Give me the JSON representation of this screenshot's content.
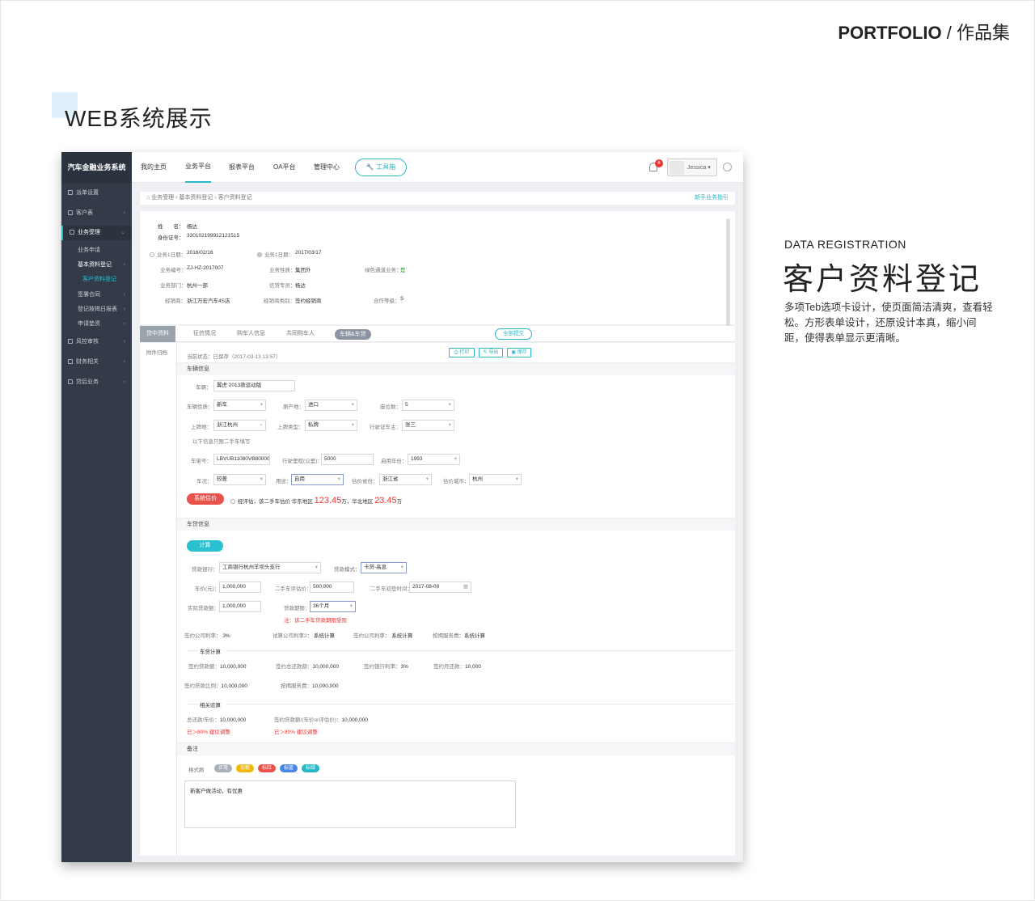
{
  "header": {
    "portfolio": "PORTFOLIO",
    "portfolio_cn": "/ 作品集"
  },
  "section_title": "WEB系统展示",
  "description": {
    "en": "DATA REGISTRATION",
    "cn": "客户资料登记",
    "text": "多项Teb选项卡设计，使页面简洁清爽，查看轻松。方形表单设计，还原设计本真，缩小间距，使得表单显示更清晰。"
  },
  "app": {
    "brand": "汽车金融业务系统",
    "sidebar": [
      {
        "label": "派单设置",
        "icon": "list-icon"
      },
      {
        "label": "客户表",
        "icon": "user-icon"
      },
      {
        "label": "业务受理",
        "icon": "gear-icon",
        "active": true
      },
      {
        "label": "业务申请"
      },
      {
        "label": "基本资料登记"
      },
      {
        "label": "客户资料登记"
      },
      {
        "label": "签署合同"
      },
      {
        "label": "登记按揭日报表"
      },
      {
        "label": "申请垫资"
      },
      {
        "label": "风控审核",
        "icon": "shield-icon"
      },
      {
        "label": "财务相关",
        "icon": "money-icon"
      },
      {
        "label": "贷后业务",
        "icon": "grid-icon"
      }
    ],
    "topnav": [
      "我的主页",
      "业务平台",
      "报表平台",
      "OA平台",
      "管理中心"
    ],
    "toolbox": "工具箱",
    "notification_count": "6",
    "username": "Jessica",
    "breadcrumb": [
      "业务受理",
      "基本资料登记",
      "客户资料登记"
    ],
    "guide": "新手业务指引",
    "customer": {
      "name_label": "姓　　名：",
      "name": "杨达",
      "id_label": "身份证号：",
      "id": "330102199912121515",
      "date1_label": "业务1日期：",
      "date1": "2016/02/16",
      "date2_label": "业务1日期：",
      "date2": "2017/03/17",
      "bizno_label": "业务编号：",
      "bizno": "ZJ-HZ-2017007",
      "biztype_label": "业务性质：",
      "biztype": "集团外",
      "green_label": "绿色通道业务：",
      "green": "是",
      "dept_label": "业务部门：",
      "dept": "杭州一部",
      "credit_label": "信贷专员：",
      "credit": "杨达",
      "dealer_label": "经销商：",
      "dealer": "浙江万宏汽车4S店",
      "dealertype_label": "经销商类别：",
      "dealertype": "签约经销商",
      "level_label": "合作等级：",
      "level": "S"
    },
    "tabs": [
      "贷中资料",
      "征信情况",
      "购车人信息",
      "共同购车人",
      "车辆&车贷"
    ],
    "all_submit": "全部提交",
    "archive": "附件归档",
    "status": "当前状态：已保存（2017-03-13 13:57）",
    "actions": {
      "print": "打印",
      "export": "导出",
      "save": "保存"
    },
    "vehicle": {
      "title": "车辆信息",
      "car_label": "车辆：",
      "car": "翼虎 2013款运动版",
      "nature_label": "车辆性质：",
      "nature": "新车",
      "origin_label": "原产地：",
      "origin": "进口",
      "seats_label": "座位数：",
      "seats": "5",
      "plate_label": "上牌地：",
      "plate": "浙江杭州",
      "platetype_label": "上牌类型：",
      "platetype": "私牌",
      "owner_label": "行驶证车主：",
      "owner": "张三",
      "note": "以下信息只限二手车填写",
      "vin_label": "车架号：",
      "vin": "LBVUB11080VB80000",
      "mileage_label": "行驶里程(公里)：",
      "mileage": "5000",
      "year_label": "启用年份：",
      "year": "1993",
      "condition_label": "车况：",
      "condition": "较差",
      "usage_label": "用途：",
      "usage": "自用",
      "province_label": "估价省份：",
      "province": "浙江省",
      "city_label": "估价城市：",
      "city": "杭州",
      "eval_btn": "系统估价",
      "eval_text1": "经评估，该二手车估价 华东地区",
      "eval_val1": "123.45",
      "eval_unit1": "万，华北地区",
      "eval_val2": "23.45",
      "eval_unit2": "万"
    },
    "loan": {
      "title": "车贷信息",
      "calc_btn": "计算",
      "bank_label": "贷款银行：",
      "bank": "工商银行杭州羊坝头支行",
      "mode_label": "贷款模式：",
      "mode": "卡贷-高息",
      "price_label": "车价(元)：",
      "price": "1,000,000",
      "eval_label": "二手车评估价：",
      "eval": "500,000",
      "evaltime_label": "二手车初登时间：",
      "evaltime": "2017-08-09",
      "amount_label": "实际贷款额：",
      "amount": "1,000,000",
      "term_label": "贷款期限：",
      "term": "36个月",
      "warn": "注：该二手车贷款期限受限",
      "rate1_label": "签约公司利率：",
      "rate1": "3%",
      "rate2_label": "试算公司利率2：",
      "rate2": "系统计算",
      "rate3_label": "签约公司利率：",
      "rate3": "系统计算",
      "fee_label": "按揭服务费：",
      "fee": "系统计算",
      "calc_title": "车贷计算",
      "c1_label": "签约贷款额：",
      "c1": "10,000,000",
      "c2_label": "签约总还款额：",
      "c2": "10,000,000",
      "c3_label": "签约银行利率：",
      "c3": "3%",
      "c4_label": "签约月还款：",
      "c4": "10,000",
      "c5_label": "签约贷款比例：",
      "c5": "10,000,000",
      "c6_label": "按揭服务费：",
      "c6": "10,000,000",
      "check_title": "相关验算",
      "k1_label": "总还款/车价：",
      "k1": "10,000,000",
      "k2_label": "签约贷款额/(车价or评估价)：",
      "k2": "10,000,000",
      "k1_warn": "已＞80% 建议调整",
      "k2_warn": "已＞80% 建议调整"
    },
    "remark": {
      "title": "备注",
      "format_label": "格式刷",
      "tags": [
        {
          "label": "正常",
          "color": "#a9b0bb"
        },
        {
          "label": "加粗",
          "color": "#f2b705"
        },
        {
          "label": "标红",
          "color": "#e8524a"
        },
        {
          "label": "标蓝",
          "color": "#4a86e8"
        },
        {
          "label": "标绿",
          "color": "#29b6c6"
        }
      ],
      "text": "新客户做活动，有优惠"
    },
    "colors": {
      "accent": "#29b6c6",
      "sidebar": "#323b47",
      "red": "#e33333"
    }
  }
}
